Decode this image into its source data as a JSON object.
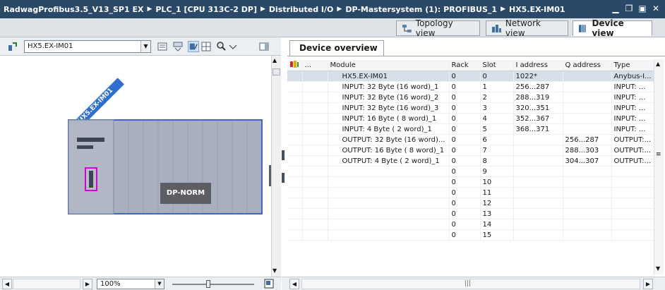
{
  "title": {
    "crumbs": [
      "RadwagProfibus3.5_V13_SP1 EX",
      "PLC_1 [CPU 313C-2 DP]",
      "Distributed I/O",
      "DP-Mastersystem (1): PROFIBUS_1",
      "HX5.EX-IM01"
    ]
  },
  "views": {
    "topology": "Topology view",
    "network": "Network view",
    "device": "Device view"
  },
  "left": {
    "device_select": "HX5.EX-IM01",
    "module_label": "HX5.EX-IM01",
    "dp_norm": "DP-NORM",
    "zoom": "100%"
  },
  "right": {
    "tab": "Device overview",
    "headers": [
      "",
      "...",
      "Module",
      "Rack",
      "Slot",
      "I address",
      "Q address",
      "Type"
    ],
    "rows": [
      {
        "module": "HX5.EX-IM01",
        "rack": "0",
        "slot": "0",
        "iaddr": "1022*",
        "qaddr": "",
        "type": "Anybus-I..."
      },
      {
        "module": "INPUT:  32 Byte (16 word)_1",
        "rack": "0",
        "slot": "1",
        "iaddr": "256...287",
        "qaddr": "",
        "type": "INPUT:  ..."
      },
      {
        "module": "INPUT:  32 Byte (16 word)_2",
        "rack": "0",
        "slot": "2",
        "iaddr": "288...319",
        "qaddr": "",
        "type": "INPUT:  ..."
      },
      {
        "module": "INPUT:  32 Byte (16 word)_3",
        "rack": "0",
        "slot": "3",
        "iaddr": "320...351",
        "qaddr": "",
        "type": "INPUT:  ..."
      },
      {
        "module": "INPUT:  16 Byte ( 8 word)_1",
        "rack": "0",
        "slot": "4",
        "iaddr": "352...367",
        "qaddr": "",
        "type": "INPUT:  ..."
      },
      {
        "module": "INPUT:   4 Byte ( 2 word)_1",
        "rack": "0",
        "slot": "5",
        "iaddr": "368...371",
        "qaddr": "",
        "type": "INPUT:  ..."
      },
      {
        "module": "OUTPUT: 32 Byte (16 word)...",
        "rack": "0",
        "slot": "6",
        "iaddr": "",
        "qaddr": "256...287",
        "type": "OUTPUT:..."
      },
      {
        "module": "OUTPUT: 16 Byte ( 8 word)_1",
        "rack": "0",
        "slot": "7",
        "iaddr": "",
        "qaddr": "288...303",
        "type": "OUTPUT:..."
      },
      {
        "module": "OUTPUT:  4 Byte ( 2 word)_1",
        "rack": "0",
        "slot": "8",
        "iaddr": "",
        "qaddr": "304...307",
        "type": "OUTPUT:..."
      },
      {
        "module": "",
        "rack": "0",
        "slot": "9",
        "iaddr": "",
        "qaddr": "",
        "type": ""
      },
      {
        "module": "",
        "rack": "0",
        "slot": "10",
        "iaddr": "",
        "qaddr": "",
        "type": ""
      },
      {
        "module": "",
        "rack": "0",
        "slot": "11",
        "iaddr": "",
        "qaddr": "",
        "type": ""
      },
      {
        "module": "",
        "rack": "0",
        "slot": "12",
        "iaddr": "",
        "qaddr": "",
        "type": ""
      },
      {
        "module": "",
        "rack": "0",
        "slot": "13",
        "iaddr": "",
        "qaddr": "",
        "type": ""
      },
      {
        "module": "",
        "rack": "0",
        "slot": "14",
        "iaddr": "",
        "qaddr": "",
        "type": ""
      },
      {
        "module": "",
        "rack": "0",
        "slot": "15",
        "iaddr": "",
        "qaddr": "",
        "type": ""
      }
    ]
  }
}
